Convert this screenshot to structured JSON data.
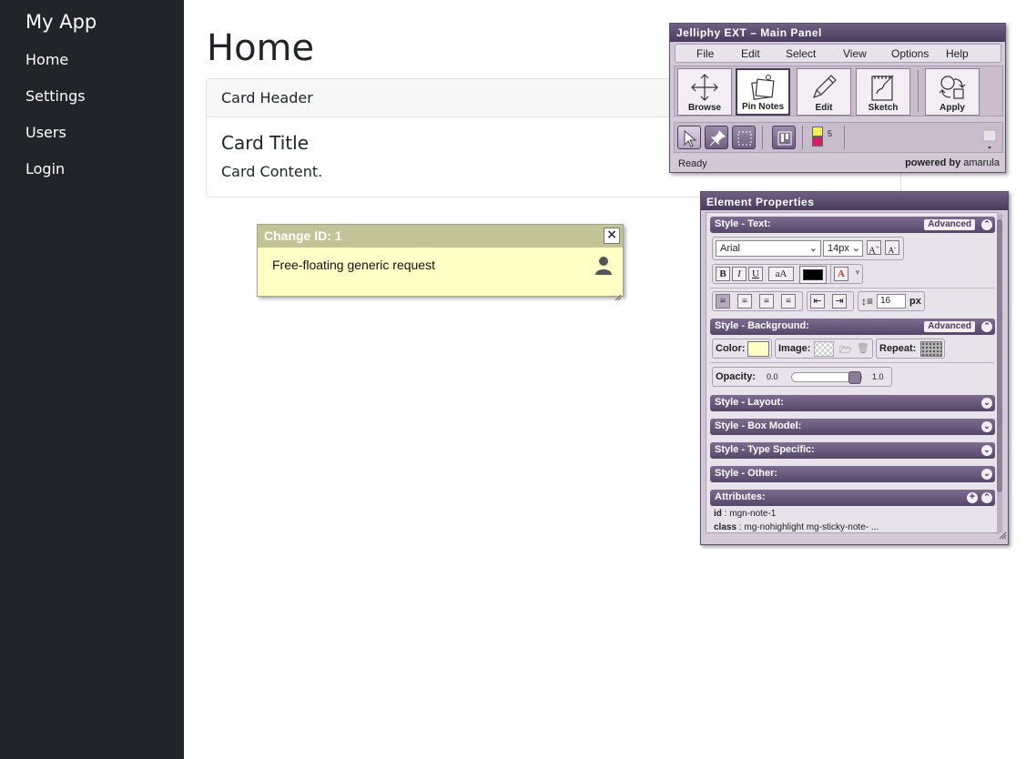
{
  "sidebar": {
    "brand": "My App",
    "items": [
      {
        "label": "Home"
      },
      {
        "label": "Settings"
      },
      {
        "label": "Users"
      },
      {
        "label": "Login"
      }
    ]
  },
  "main": {
    "title": "Home",
    "card": {
      "header": "Card Header",
      "title": "Card Title",
      "content": "Card Content."
    }
  },
  "note": {
    "header": "Change ID:  1",
    "text": "Free-floating generic request",
    "close": "×"
  },
  "jelliphy": {
    "title": "Jelliphy EXT –  Main Panel",
    "menu": [
      "File",
      "Edit",
      "Select",
      "View",
      "Options",
      "Help"
    ],
    "tools": [
      {
        "label": "Browse",
        "icon": "browse-icon"
      },
      {
        "label": "Pin Notes",
        "icon": "pin-notes-icon",
        "active": true
      },
      {
        "label": "Edit",
        "icon": "pencil-icon"
      },
      {
        "label": "Sketch",
        "icon": "sketch-icon"
      },
      {
        "label": "Apply",
        "icon": "apply-icon"
      }
    ],
    "status": "Ready",
    "powered_prefix": "powered by",
    "powered_brand": "amarula",
    "color_counter": "5"
  },
  "props": {
    "title": "Element Properties",
    "sections": {
      "text": "Style - Text:",
      "background": "Style - Background:",
      "layout": "Style - Layout:",
      "box_model": "Style - Box Model:",
      "type_specific": "Style - Type Specific:",
      "other": "Style - Other:",
      "attributes": "Attributes:"
    },
    "advanced_label": "Advanced",
    "font_family": "Arial",
    "font_size": "14px",
    "line_height": "16",
    "line_height_unit": "px",
    "bg_color_label": "Color:",
    "bg_image_label": "Image:",
    "bg_repeat_label": "Repeat:",
    "opacity_label": "Opacity:",
    "opacity_min": "0.0",
    "opacity_max": "1.0",
    "opacity_value": 1.0,
    "bg_color": "#ffffc6",
    "text_color": "#000000",
    "attributes": [
      {
        "key": "id",
        "value": "mgn-note-1"
      },
      {
        "key": "class",
        "value": "mg-nohighlight mg-sticky-note- ..."
      }
    ]
  }
}
